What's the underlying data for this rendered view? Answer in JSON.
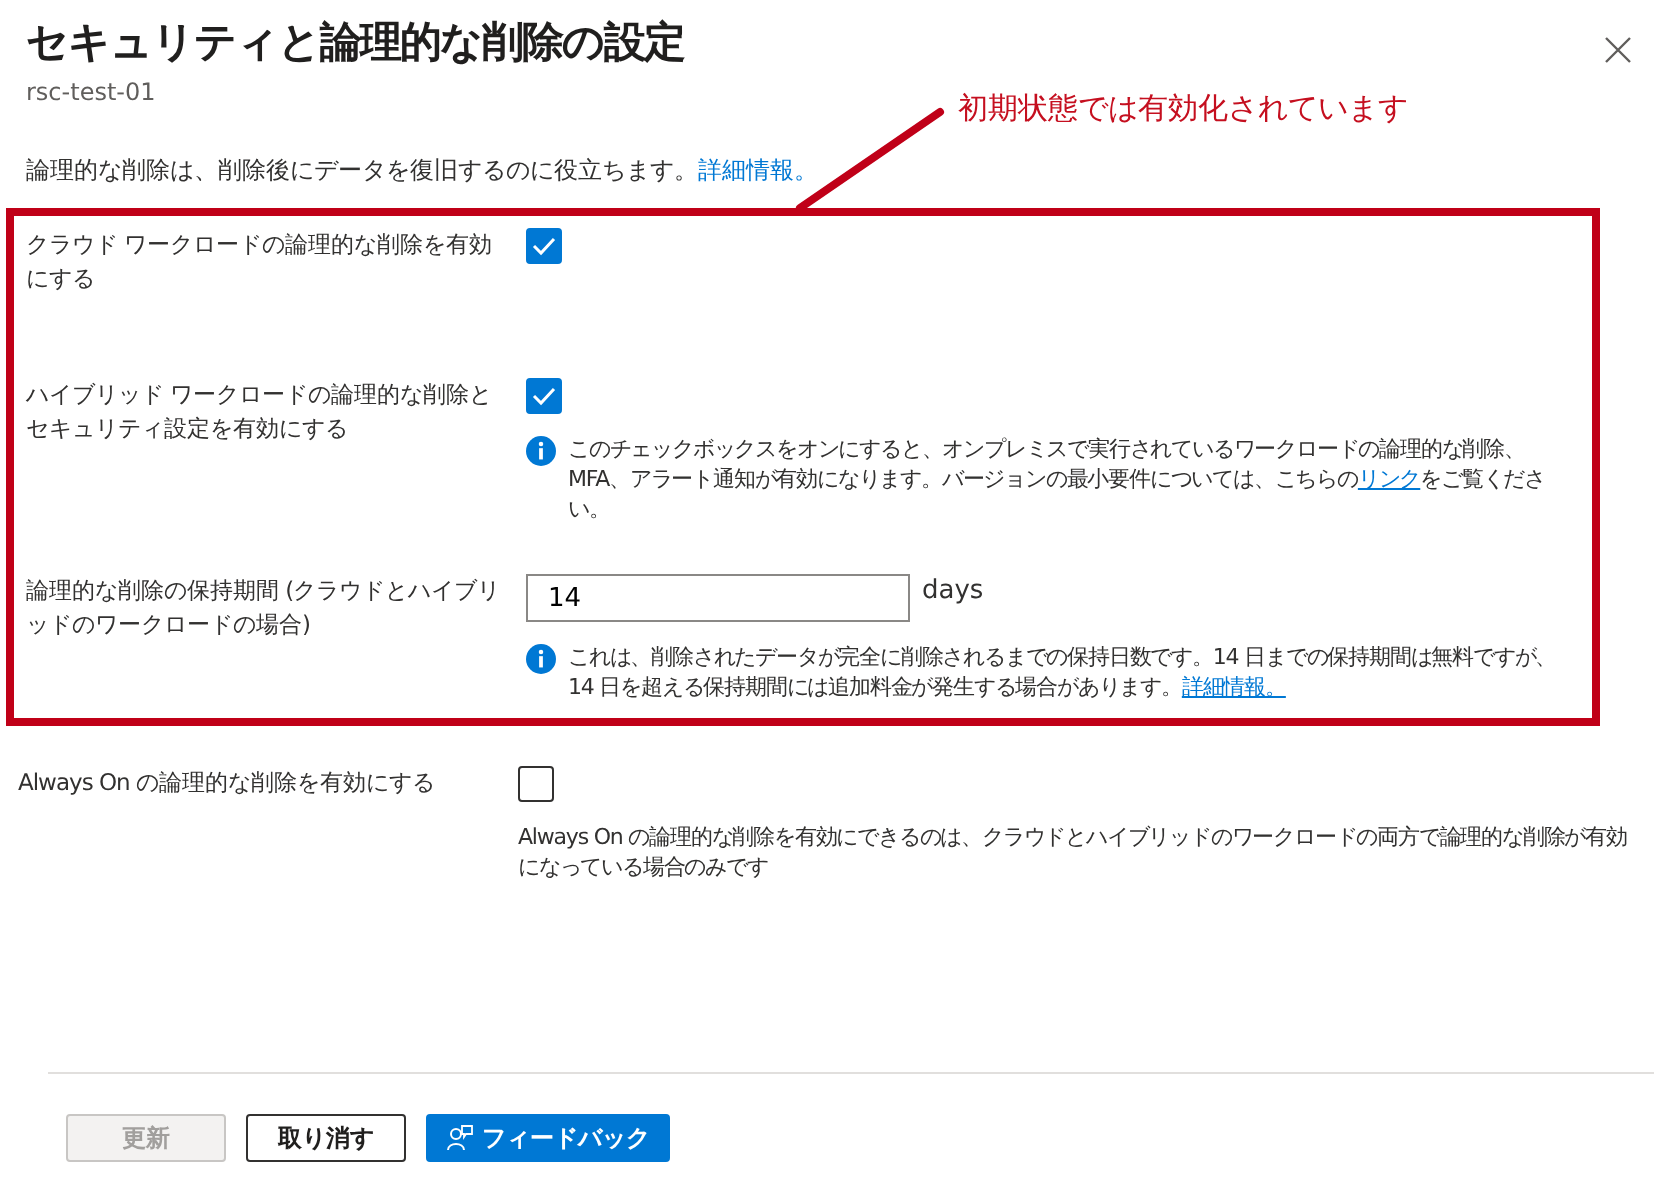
{
  "title": "セキュリティと論理的な削除の設定",
  "subtitle": "rsc-test-01",
  "annotation": {
    "text": "初期状態では有効化されています"
  },
  "intro": {
    "text": "論理的な削除は、削除後にデータを復旧するのに役立ちます。",
    "link": "詳細情報。"
  },
  "highlighted_settings": [
    {
      "kind": "checkbox",
      "label": "クラウド ワークロードの論理的な削除を有効にする",
      "checked": true
    },
    {
      "kind": "checkbox",
      "label": "ハイブリッド ワークロードの論理的な削除とセキュリティ設定を有効にする",
      "checked": true,
      "note": {
        "kind": "info",
        "parts": [
          {
            "kind": "text",
            "text": "このチェックボックスをオンにすると、オンプレミスで実行されているワークロードの論理的な削除、MFA、アラート通知が有効になります。バージョンの最小要件については、こちらの"
          },
          {
            "kind": "link",
            "text": "リンク"
          },
          {
            "kind": "text",
            "text": "をご覧ください。"
          }
        ]
      }
    },
    {
      "kind": "number",
      "label": "論理的な削除の保持期間 (クラウドとハイブリッドのワークロードの場合)",
      "value": "14",
      "unit": "days",
      "note": {
        "kind": "info",
        "parts": [
          {
            "kind": "text",
            "text": "これは、削除されたデータが完全に削除されるまでの保持日数です。14 日までの保持期間は無料ですが、14 日を超える保持期間には追加料金が発生する場合があります。"
          },
          {
            "kind": "link",
            "text": "詳細情報。"
          }
        ]
      }
    }
  ],
  "other_settings": [
    {
      "kind": "checkbox",
      "label": "Always On の論理的な削除を有効にする",
      "checked": false,
      "note": {
        "kind": "plain",
        "parts": [
          {
            "kind": "text",
            "text": "Always On の論理的な削除を有効にできるのは、クラウドとハイブリッドのワークロードの両方で論理的な削除が有効になっている場合のみです"
          }
        ]
      }
    }
  ],
  "buttons": [
    {
      "label": "更新",
      "kind": "secondary",
      "disabled": true
    },
    {
      "label": "取り消す",
      "kind": "secondary",
      "disabled": false
    },
    {
      "label": "フィードバック",
      "kind": "primary",
      "disabled": false
    }
  ]
}
